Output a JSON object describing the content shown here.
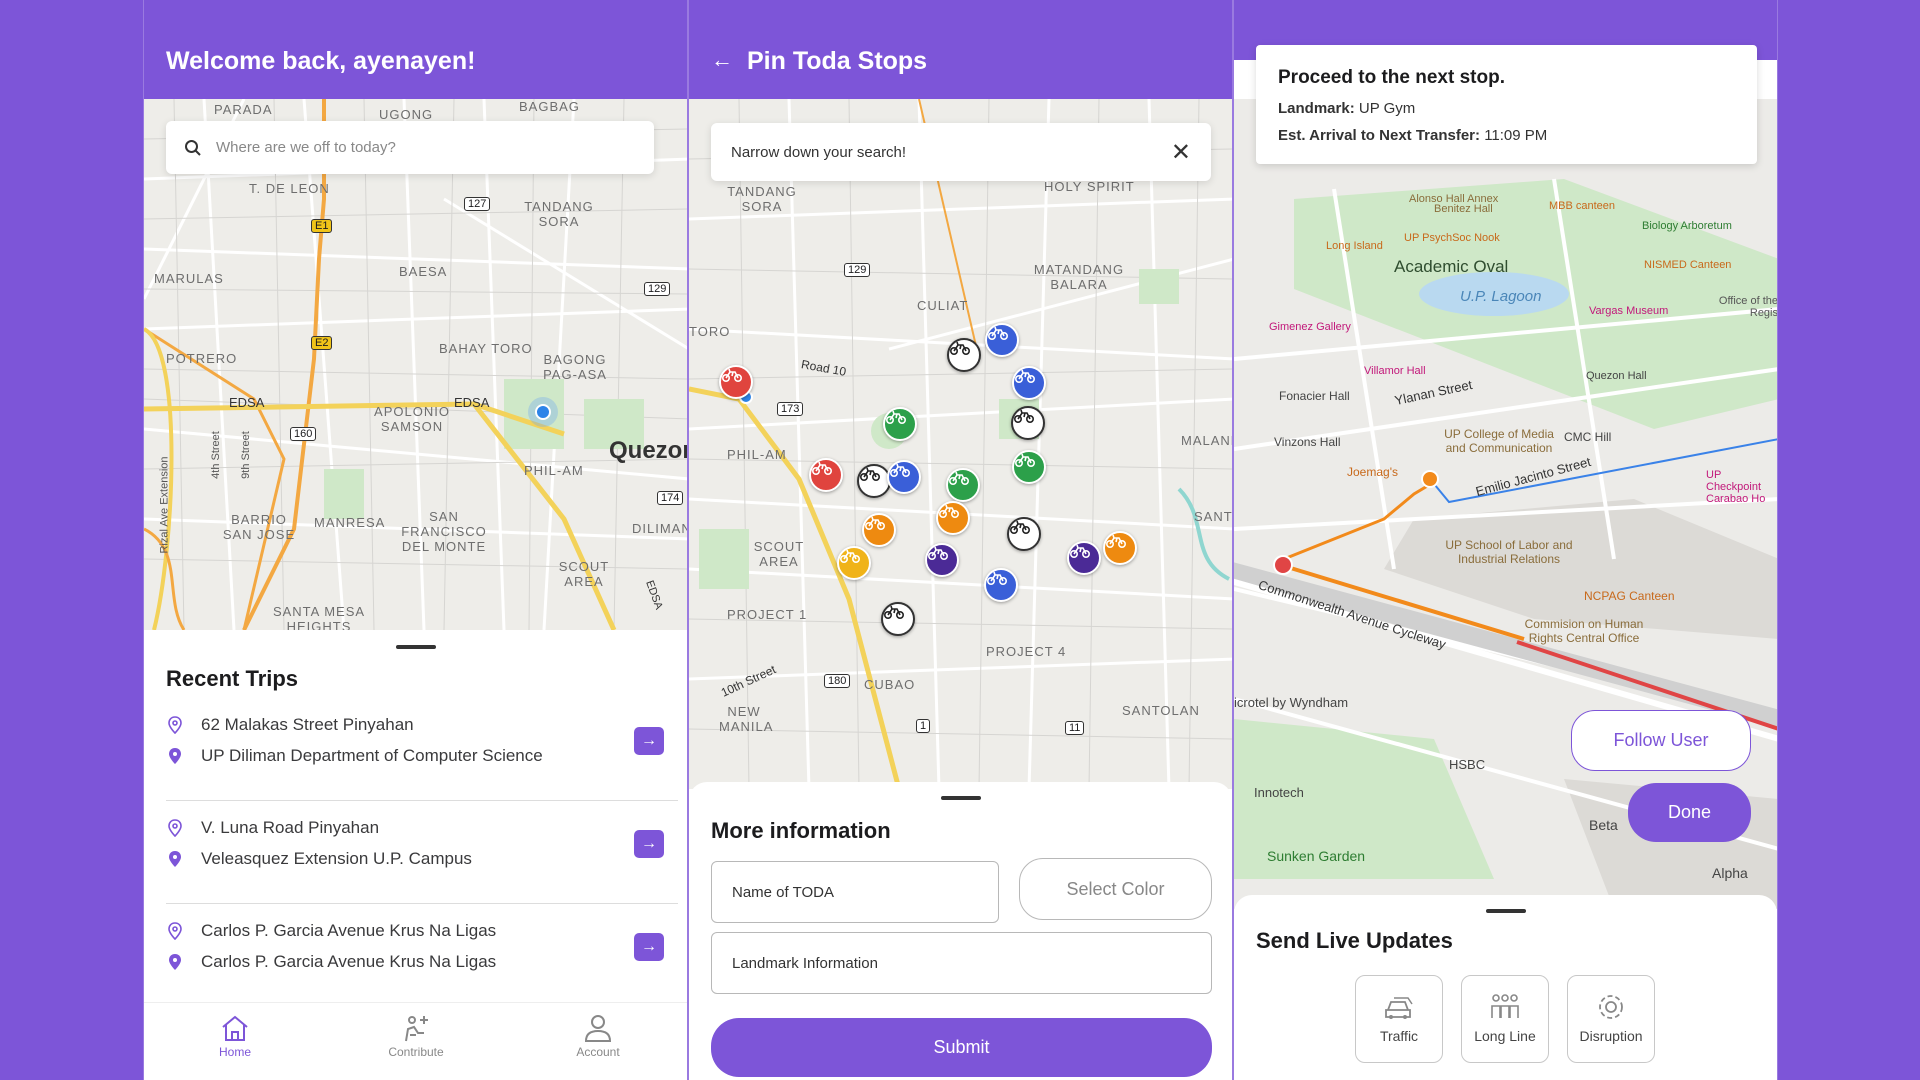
{
  "colors": {
    "primary": "#7d55d8",
    "marker_red": "#e0443e",
    "marker_green": "#2ca04a",
    "marker_blue": "#3a5fd8",
    "marker_orange": "#ee8a10",
    "marker_yellow": "#f0b319",
    "marker_purple": "#4b2a96"
  },
  "home": {
    "title": "Welcome back, ayenayen!",
    "search_placeholder": "Where are we off to today?",
    "map_labels": [
      "PARADA",
      "UGONG",
      "BAGBAG",
      "T. DE LEON",
      "TANDANG SORA",
      "BAESA",
      "MARULAS",
      "BAHAY TORO",
      "BAGONG PAG-ASA",
      "POTRERO",
      "EDSA",
      "EDSA",
      "APOLONIO SAMSON",
      "Quezon",
      "PHIL-AM",
      "SAN FRANCISCO DEL MONTE",
      "BARRIO SAN JOSE",
      "MANRESA",
      "DILIMAN",
      "SCOUT AREA",
      "SANTA MESA HEIGHTS",
      "Rizal Ave Extension",
      "4th Street",
      "9th Street",
      "EDSA"
    ],
    "route_shields": [
      "127",
      "E1",
      "129",
      "E2",
      "160",
      "174"
    ],
    "recent_trips_title": "Recent Trips",
    "trips": [
      {
        "from": "62 Malakas Street Pinyahan",
        "to": "UP Diliman Department of Computer Science"
      },
      {
        "from": "V. Luna Road Pinyahan",
        "to": "Veleasquez Extension U.P. Campus"
      },
      {
        "from": "Carlos P. Garcia Avenue Krus Na Ligas",
        "to": "Carlos P. Garcia Avenue Krus Na Ligas"
      }
    ],
    "tabs": [
      {
        "label": "Home",
        "icon": "home-icon"
      },
      {
        "label": "Contribute",
        "icon": "contribute-icon"
      },
      {
        "label": "Account",
        "icon": "account-icon"
      }
    ]
  },
  "pin": {
    "title": "Pin Toda Stops",
    "search_placeholder": "Narrow down your search!",
    "map_labels": [
      "HOLY SPIRIT",
      "TANDANG SORA",
      "MATANDANG BALARA",
      "CULIAT",
      "TORO",
      "Road 10",
      "PHIL-AM",
      "MALAND",
      "SCOUT AREA",
      "PROJECT 1",
      "PROJECT 4",
      "10th Street",
      "CUBAO",
      "NEW MANILA",
      "SANTOLAN",
      "SANT"
    ],
    "route_shields": [
      "129",
      "173",
      "180",
      "1",
      "11"
    ],
    "more_info_title": "More information",
    "name_placeholder": "Name of TODA",
    "color_button": "Select Color",
    "landmark_placeholder": "Landmark Information",
    "submit": "Submit"
  },
  "nav": {
    "card_title": "Proceed to the next stop.",
    "landmark_label": "Landmark:",
    "landmark_value": "UP Gym",
    "eta_label": "Est. Arrival to Next Transfer:",
    "eta_value": "11:09 PM",
    "map_labels": [
      "Alonso Hall Annex",
      "MBB canteen",
      "Benitez Hall",
      "Biology Arboretum",
      "UP PsychSoc Nook",
      "Long Island",
      "Academic Oval",
      "NISMED Canteen",
      "U.P. Lagoon",
      "Office of the Regis",
      "Gimenez Gallery",
      "Vargas Museum",
      "Villamor Hall",
      "Fonacier Hall",
      "Ylanan Street",
      "Quezon Hall",
      "UP College of Media and Communication",
      "CMC Hill",
      "Vinzons Hall",
      "Joemag's",
      "Emilio Jacinto Street",
      "UP School of Labor and Industrial Relations",
      "NCPAG Canteen",
      "Commonwealth Avenue Cycleway",
      "Commision on Human Rights Central Office",
      "icrotel by Wyndham",
      "HSBC",
      "Innotech",
      "Sunken Garden",
      "Beta",
      "Alpha",
      "UP Checkpoint Carabao Ho"
    ],
    "follow_user": "Follow User",
    "done": "Done",
    "send_updates_title": "Send Live Updates",
    "actions": [
      {
        "label": "Traffic",
        "icon": "traffic-car-icon"
      },
      {
        "label": "Long Line",
        "icon": "people-line-icon"
      },
      {
        "label": "Disruption",
        "icon": "gear-icon"
      }
    ]
  }
}
